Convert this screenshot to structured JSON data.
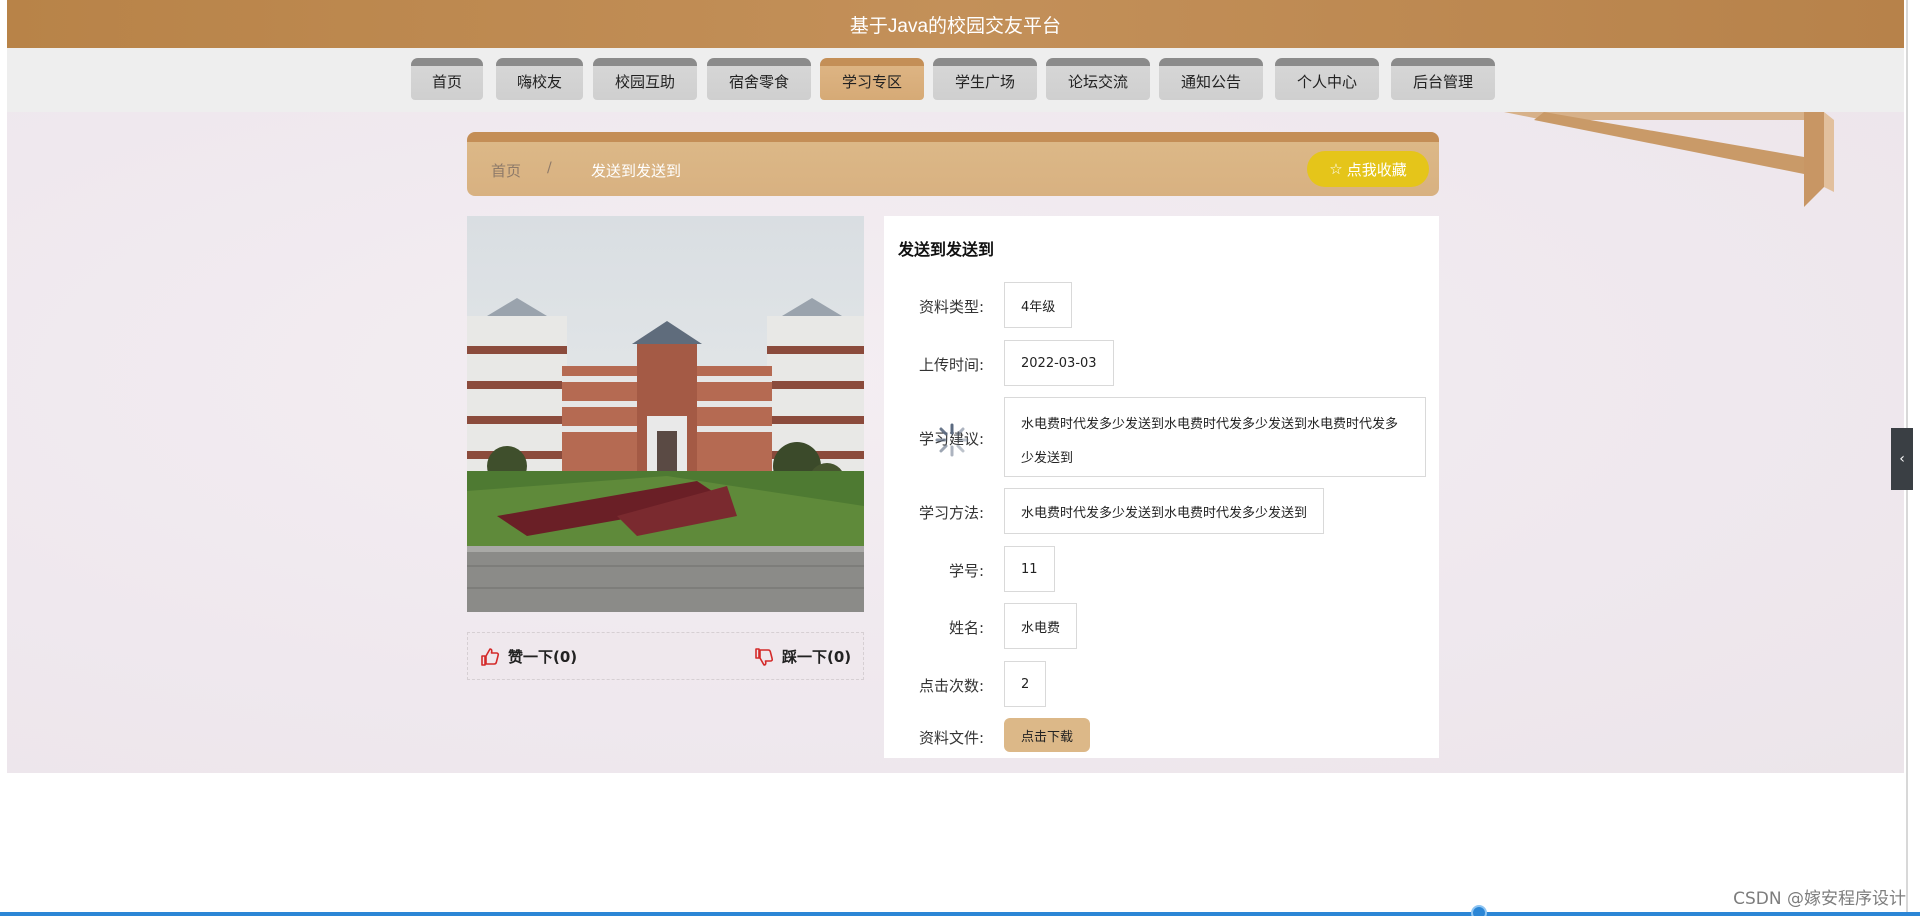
{
  "header": {
    "title": "基于Java的校园交友平台"
  },
  "nav": {
    "items": [
      {
        "label": "首页"
      },
      {
        "label": "嗨校友"
      },
      {
        "label": "校园互助"
      },
      {
        "label": "宿舍零食"
      },
      {
        "label": "学习专区",
        "active": true
      },
      {
        "label": "学生广场"
      },
      {
        "label": "论坛交流"
      },
      {
        "label": "通知公告"
      },
      {
        "label": "个人中心"
      },
      {
        "label": "后台管理"
      }
    ]
  },
  "breadcrumb": {
    "home": "首页",
    "separator": "/",
    "current": "发送到发送到"
  },
  "favorite_button": {
    "label": "点我收藏",
    "icon": "star-outline-icon"
  },
  "votes": {
    "like": {
      "label": "赞一下(0)",
      "icon": "thumbs-up-icon"
    },
    "dislike": {
      "label": "踩一下(0)",
      "icon": "thumbs-down-icon"
    }
  },
  "detail": {
    "title": "发送到发送到",
    "fields": {
      "type": {
        "label": "资料类型:",
        "value": "4年级"
      },
      "upload_time": {
        "label": "上传时间:",
        "value": "2022-03-03"
      },
      "suggestion": {
        "label": "学习建议:",
        "value": "水电费时代发多少发送到水电费时代发多少发送到水电费时代发多少发送到"
      },
      "method": {
        "label": "学习方法:",
        "value": "水电费时代发多少发送到水电费时代发多少发送到"
      },
      "student_id": {
        "label": "学号:",
        "value": "11"
      },
      "name": {
        "label": "姓名:",
        "value": "水电费"
      },
      "clicks": {
        "label": "点击次数:",
        "value": "2"
      },
      "file": {
        "label": "资料文件:",
        "button": "点击下载"
      }
    }
  },
  "watermark": "CSDN @嫁安程序设计",
  "colors": {
    "header": "#b88348",
    "nav_active": "#ddb483",
    "favorite": "#e5c51a",
    "download": "#dcb888",
    "vote_icon": "#d42a2a"
  }
}
